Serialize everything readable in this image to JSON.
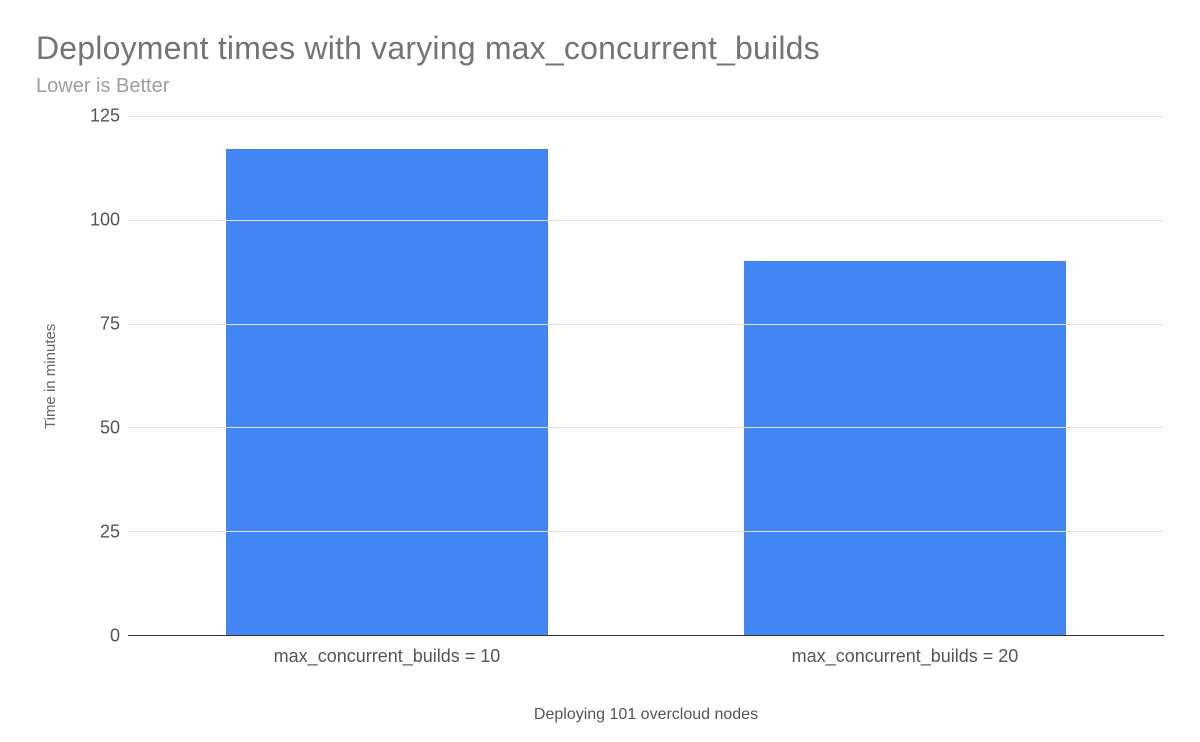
{
  "chart_data": {
    "type": "bar",
    "title": "Deployment times with varying max_concurrent_builds",
    "subtitle": "Lower is Better",
    "xlabel": "Deploying 101 overcloud nodes",
    "ylabel": "Time in minutes",
    "ylim": [
      0,
      125
    ],
    "y_ticks": [
      0,
      25,
      50,
      75,
      100,
      125
    ],
    "categories": [
      "max_concurrent_builds = 10",
      "max_concurrent_builds = 20"
    ],
    "values": [
      117,
      90
    ],
    "bar_color": "#4285f4"
  }
}
